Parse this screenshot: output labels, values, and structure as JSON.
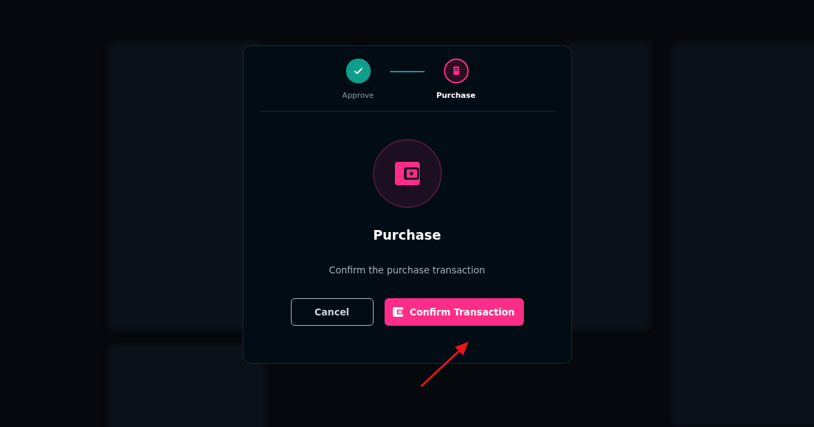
{
  "steps": [
    {
      "label": "Approve",
      "completed": true,
      "selected": false
    },
    {
      "label": "Purchase",
      "completed": false,
      "selected": true
    }
  ],
  "dialog": {
    "title": "Purchase",
    "message": "Confirm the purchase transaction"
  },
  "buttons": [
    {
      "label": "Cancel",
      "kind": "secondary"
    },
    {
      "label": "Confirm Transaction",
      "kind": "primary"
    }
  ]
}
